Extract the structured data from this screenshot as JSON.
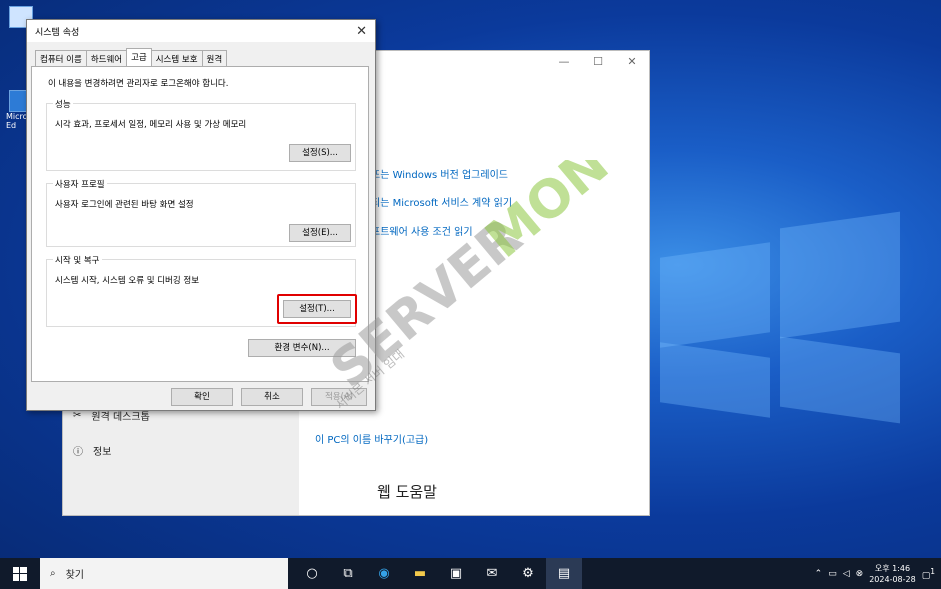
{
  "desktop": {
    "icons": [
      {
        "label": ""
      },
      {
        "label": "Micro Ed"
      }
    ]
  },
  "settings_window": {
    "controls": {
      "minimize": "—",
      "maximize": "☐",
      "close": "✕"
    },
    "links": [
      "또는 Windows 버전 업그레이드",
      "되는 Microsoft 서비스 계약 읽기",
      "프트웨어 사용 조건 읽기",
      "이 PC의 이름 바꾸기(고급)"
    ],
    "nav": [
      {
        "icon": "remote-desktop-icon",
        "label": "원격 데스크톱"
      },
      {
        "icon": "info-icon",
        "label": "정보"
      }
    ],
    "help_heading": "웹 도움말"
  },
  "dialog": {
    "title": "시스템 속성",
    "close": "✕",
    "tabs": [
      "컴퓨터 이름",
      "하드웨어",
      "고급",
      "시스템 보호",
      "원격"
    ],
    "active_tab": "고급",
    "admin_note": "이 내용을 변경하려면 관리자로 로그온해야 합니다.",
    "groups": [
      {
        "title": "성능",
        "desc": "시각 효과, 프로세서 일정, 메모리 사용 및 가상 메모리",
        "button": "설정(S)..."
      },
      {
        "title": "사용자 프로필",
        "desc": "사용자 로그인에 관련된 바탕 화면 설정",
        "button": "설정(E)..."
      },
      {
        "title": "시작 및 복구",
        "desc": "시스템 시작, 시스템 오류 및 디버깅 정보",
        "button": "설정(T)..."
      }
    ],
    "env_button": "환경 변수(N)...",
    "ok": "확인",
    "cancel": "취소",
    "apply": "적용(A)"
  },
  "watermark": {
    "brand_left": "SERVER",
    "brand_right": "MON",
    "sub": "서버몬 서버 임대"
  },
  "taskbar": {
    "search_placeholder": "찾기",
    "icons": [
      "cortana-icon",
      "task-view-icon",
      "edge-icon",
      "explorer-icon",
      "store-icon",
      "mail-icon",
      "settings-icon",
      "system-properties-icon"
    ],
    "clock_time": "오후 1:46",
    "clock_date": "2024-08-28",
    "notification_count": "1"
  },
  "colors": {
    "link": "#0067c0",
    "highlight": "#e00000",
    "taskbar": "#101a2b"
  }
}
